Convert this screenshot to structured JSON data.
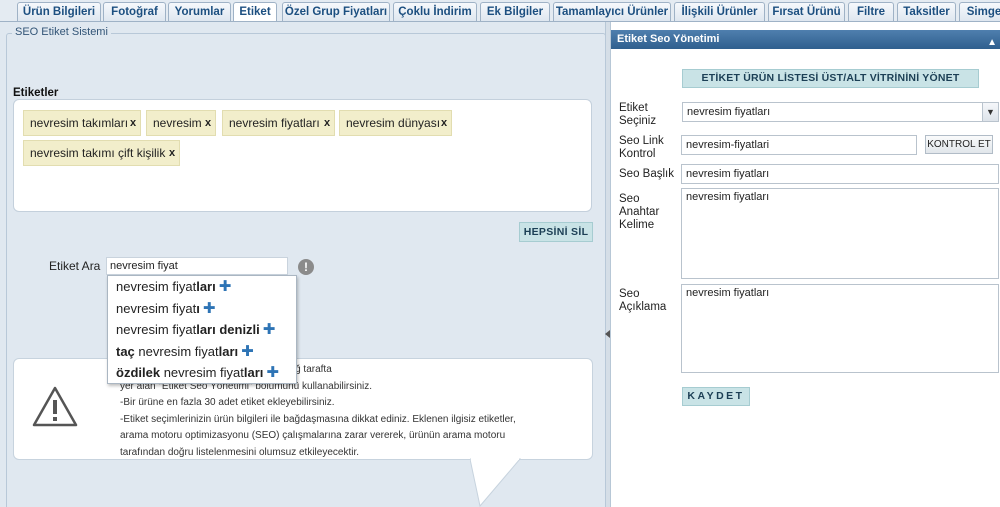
{
  "tabs": [
    {
      "label": "Ürün Bilgileri"
    },
    {
      "label": "Fotoğraf"
    },
    {
      "label": "Yorumlar"
    },
    {
      "label": "Etiket"
    },
    {
      "label": "Özel Grup Fiyatları"
    },
    {
      "label": "Çoklu İndirim"
    },
    {
      "label": "Ek Bilgiler"
    },
    {
      "label": "Tamamlayıcı Ürünler"
    },
    {
      "label": "İlişkili Ürünler"
    },
    {
      "label": "Fırsat Ürünü"
    },
    {
      "label": "Filtre"
    },
    {
      "label": "Taksitler"
    },
    {
      "label": "Simge"
    }
  ],
  "active_tab": "Etiket",
  "left": {
    "legend": "SEO Etiket Sistemi",
    "tags_label": "Etiketler",
    "tags": [
      {
        "text": "nevresim takımları",
        "remove": "x"
      },
      {
        "text": "nevresim",
        "remove": "x"
      },
      {
        "text": "nevresim fiyatları",
        "remove": "x"
      },
      {
        "text": "nevresim dünyası",
        "remove": "x"
      },
      {
        "text": "nevresim takımı çift kişilik",
        "remove": "x"
      }
    ],
    "delete_all_label": "HEPSİNİ SİL",
    "search_label": "Etiket Ara",
    "search_value": "nevresim fiyat",
    "suggestions": [
      {
        "pre": "",
        "normal": "nevresim fiyat",
        "bold": "ları"
      },
      {
        "pre": "",
        "normal": "nevresim fiyat",
        "bold": "ı"
      },
      {
        "pre": "",
        "normal": "nevresim fiyat",
        "bold": "ları denizli"
      },
      {
        "pre": "taç",
        "normal": " nevresim fiyat",
        "bold": "ları"
      },
      {
        "pre": "özdilek",
        "normal": " nevresim fiyat",
        "bold": "ları"
      }
    ],
    "info_lines": [
      "etiketin üzerine tıklayabilirsiniz ya da sağ tarafta",
      "yer alan \"Etiket Seo Yönetimi\" bölümünü kullanabilirsiniz.",
      "-Bir ürüne en fazla 30 adet etiket ekleyebilirsiniz.",
      "-Etiket seçimlerinizin ürün bilgileri ile bağdaşmasına dikkat ediniz. Eklenen ilgisiz etiketler,",
      "arama motoru optimizasyonu (SEO) çalışmalarına zarar vererek, ürünün arama motoru",
      "tarafından doğru listelenmesini olumsuz etkileyecektir."
    ]
  },
  "right": {
    "header": "Etiket Seo Yönetimi",
    "vitrin_button": "ETİKET ÜRÜN LİSTESİ ÜST/ALT VİTRİNİNİ YÖNET",
    "select_label": "Etiket Seçiniz",
    "select_value": "nevresim fiyatları",
    "link_label": "Seo Link Kontrol",
    "link_value": "nevresim-fiyatlari",
    "kontrol_button": "KONTROL ET",
    "title_label": "Seo Başlık",
    "title_value": "nevresim fiyatları",
    "keywords_label": "Seo Anahtar Kelime",
    "keywords_value": "nevresim fiyatları",
    "desc_label": "Seo Açıklama",
    "desc_value": "nevresim fiyatları",
    "save_button": "KAYDET"
  },
  "colors": {
    "tab_text": "#1c4f80",
    "panel_bg": "#e0e8f0",
    "header_blue": "#3f6f9e",
    "action_button": "#c9e3e6",
    "tag_bg": "#f2eecb",
    "plus_icon": "#2e74b5"
  }
}
